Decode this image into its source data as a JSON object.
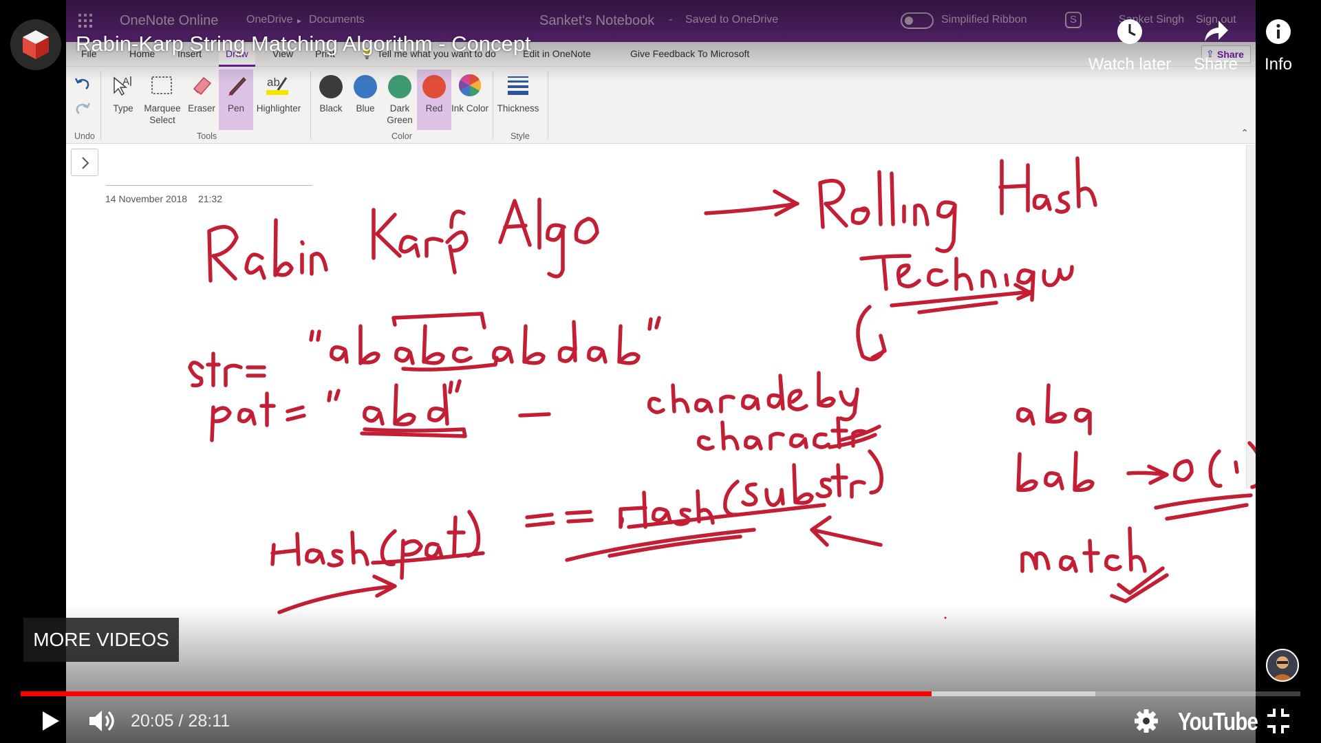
{
  "onenote": {
    "app_name": "OneNote Online",
    "breadcrumb": [
      "OneDrive",
      "Documents"
    ],
    "notebook_title": "Sanket's Notebook",
    "save_status": "Saved to OneDrive",
    "simplified_ribbon_label": "Simplified Ribbon",
    "user_name": "Sanket Singh",
    "sign_out": "Sign out",
    "tabs": [
      "File",
      "Home",
      "Insert",
      "Draw",
      "View",
      "Print"
    ],
    "tell_me_placeholder": "Tell me what you want to do",
    "open_in_onenote": "Edit in OneNote",
    "feedback": "Give Feedback To Microsoft",
    "share_label": "Share",
    "ribbon": {
      "undo_group": "Undo",
      "tools_group": "Tools",
      "color_group": "Color",
      "style_group": "Style",
      "tools": [
        "Type",
        "Marquee Select",
        "Eraser",
        "Pen",
        "Highlighter"
      ],
      "colors": [
        {
          "label": "Black",
          "hex": "#3b3b3b"
        },
        {
          "label": "Blue",
          "hex": "#3a78c3"
        },
        {
          "label": "Dark Green",
          "hex": "#3f9a72"
        },
        {
          "label": "Red",
          "hex": "#e04e39"
        }
      ],
      "ink_color": "Ink Color",
      "thickness": "Thickness"
    },
    "page_date": "14 November 2018",
    "page_time": "21:32"
  },
  "youtube": {
    "video_title": "Rabin-Karp String Matching Algorithm - Concept",
    "watch_later": "Watch later",
    "share": "Share",
    "info": "Info",
    "more_videos": "MORE VIDEOS",
    "current_time": "20:05",
    "duration": "28:11",
    "played_fraction": 0.712,
    "buffered_fraction": 0.84,
    "wordmark": "YouTube",
    "accent": "#ff0000"
  }
}
